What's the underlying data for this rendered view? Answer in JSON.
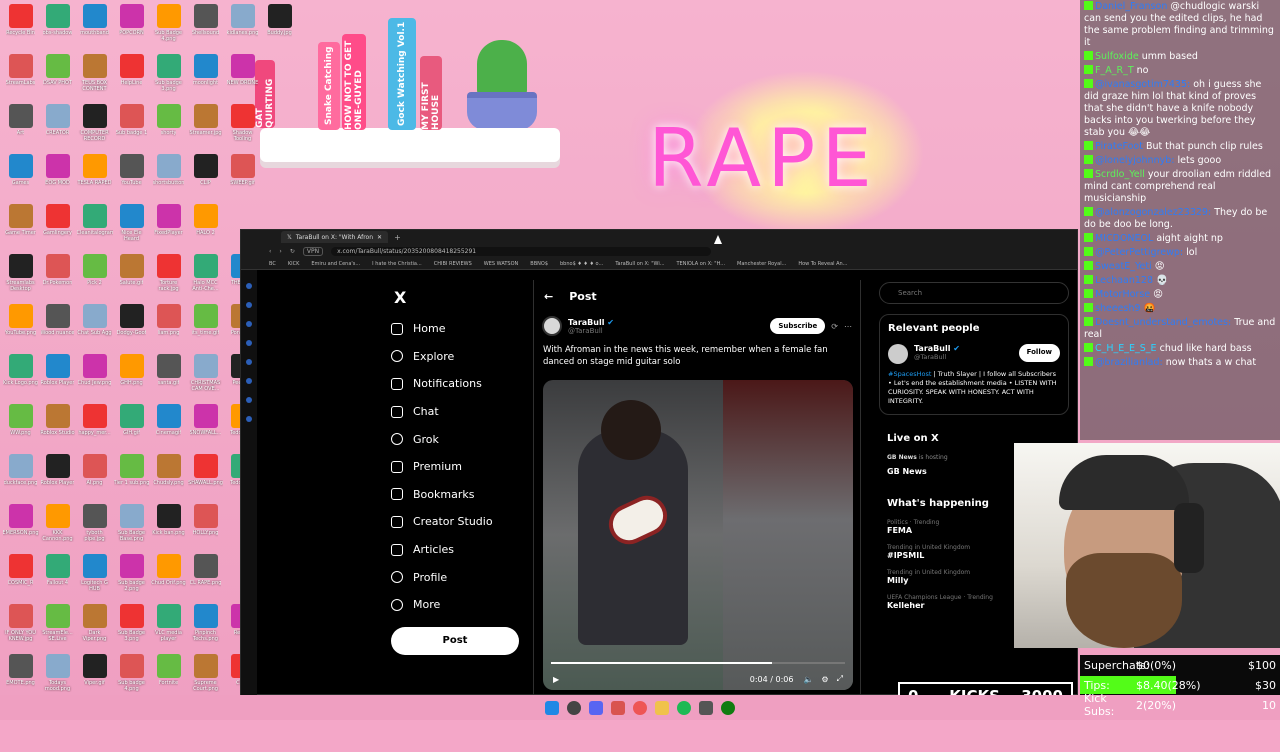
{
  "wallpaper": {
    "sign_text": "RAPE",
    "books": [
      "Snake Catching",
      "HOW NOT TO GET ONE-GUYED",
      "Gock Watching Vol.1",
      "MY FIRST HOUSE",
      "GAT QUIRTING"
    ]
  },
  "desktop_icons": [
    "Recycle Bin",
    "obs-shadow",
    "mouthband",
    "POPCORN",
    "Sub Badge 4.png",
    "Shellsound",
    "kidlanes.png",
    "Buddy.jpg",
    "StreamLabs",
    "DSAV PHOT",
    "TEUS BOX CONTENT",
    "HelpLine",
    "Sub badge 3.png",
    "moonlight",
    "NEW DRONE",
    "",
    "Art",
    "CREATOR",
    "COMPUTER RECORD",
    "Sub badge 1",
    "shorty",
    "Streamer.jpg",
    "Shadow Tooling",
    "",
    "Games",
    "EOG MOD",
    "TESLA RAPED",
    "YouTube",
    "shortsbutton",
    "CLIP",
    "SWEEP.gif",
    "",
    "Game Timer",
    "Gamlingery",
    "Cleanitalogram",
    "Nice Ele Heard",
    "FixedPlayer",
    "HALO 2",
    "",
    "",
    "Streamlabs Desktop",
    "Dr.Pokemon",
    "Pick 2",
    "Salute.gif",
    "Torture rack.jpg",
    "Halo MCC Anti-Che...",
    "THE SELL",
    "",
    "YouTube.png",
    "Wood nuance",
    "Chat Sub Agg",
    "Dodgy-Goof",
    "liam.png",
    "its_time.gif",
    "Pong.png",
    "",
    "Kick Logo.png",
    "Roblox Player",
    "Chud Jew.png",
    "GHH.png",
    "santa.gif",
    "CHRISTMAS CAM OVE...",
    "Pee.png",
    "",
    "WW.png",
    "Roblox Studio",
    "happy_mer...",
    "GIH.gif",
    "Cinemagif",
    "SNOWFALL...",
    "Teddy.png",
    "",
    "duckface.png",
    "Roblox Player",
    "AI.png",
    "Tier 1 sub.png",
    "Chudsly.png",
    "SHAWALL.png",
    "Teddy.png",
    "",
    "EMERSON.png",
    "KKK Cannon.png",
    "tyboth pipe.jpg",
    "Sub Badge Base.png",
    "Kick ban.png",
    "HOLLY.png",
    "",
    "",
    "COSMIC_R",
    "Fallout 4",
    "Logitech G HUB",
    "Sub badge 2.png",
    "Chud Orif.png",
    "CL RAPE.png",
    "",
    "",
    "IF ONLY YOU KNEW.jpg",
    "StreamEle... SE.Live",
    "Dark Viper.png",
    "Sub Badge 3.png",
    "VLC media player",
    "Pinpinch Techs.png",
    "Recent",
    "",
    "EMOTE.png",
    "Todays mood.png",
    "Viper.gif",
    "Sub badge 4.png",
    "Fortnite",
    "Supreme Court.png",
    "Chud",
    "",
    "",
    "",
    "",
    "",
    "",
    "",
    "",
    ""
  ],
  "browser": {
    "tab_title": "TaraBull on X: \"With Afron",
    "url": "x.com/TaraBull/status/2035200808418255291",
    "vpn": "VPN",
    "bookmarks": [
      "BC",
      "KICK",
      "Emiru and Cena's...",
      "I hate the Christia...",
      "CHIBI REVIEWS",
      "WES WATSON",
      "BBNO$",
      "bbno$ ♦ ♦ ♦ o...",
      "TaraBull on X: \"Wi...",
      "TENIOLA on X: \"H...",
      "Manchester Royal...",
      "How To Reveal An..."
    ]
  },
  "x": {
    "logo": "X",
    "nav": [
      {
        "label": "Home",
        "icon": "home-icon"
      },
      {
        "label": "Explore",
        "icon": "search-icon"
      },
      {
        "label": "Notifications",
        "icon": "bell-icon"
      },
      {
        "label": "Chat",
        "icon": "mail-icon"
      },
      {
        "label": "Grok",
        "icon": "grok-icon"
      },
      {
        "label": "Premium",
        "icon": "premium-icon"
      },
      {
        "label": "Bookmarks",
        "icon": "bookmark-icon"
      },
      {
        "label": "Creator Studio",
        "icon": "rocket-icon"
      },
      {
        "label": "Articles",
        "icon": "article-icon"
      },
      {
        "label": "Profile",
        "icon": "person-icon"
      },
      {
        "label": "More",
        "icon": "more-icon"
      }
    ],
    "post_button": "Post",
    "post_header": "Post",
    "post": {
      "author": "TaraBull",
      "handle": "@TaraBull",
      "subscribe": "Subscribe",
      "text": "With Afroman in the news this week, remember when a female fan danced on stage mid guitar solo",
      "video_time": "0:04 / 0:06",
      "video_progress": 0.75
    },
    "search_placeholder": "Search",
    "relevant": {
      "title": "Relevant people",
      "name": "TaraBull",
      "handle": "@TaraBull",
      "follow": "Follow",
      "bio_tag": "#SpacesHost",
      "bio": "| Truth Slayer | I follow all Subscribers • Let's end the establishment media • LISTEN WITH CURIOSITY. SPEAK WITH HONESTY. ACT WITH INTEGRITY."
    },
    "live": {
      "title": "Live on X",
      "host": "GB News",
      "hosting": "is hosting",
      "show": "GB News"
    },
    "happening": {
      "title": "What's happening",
      "trends": [
        {
          "cat": "Politics · Trending",
          "name": "FEMA"
        },
        {
          "cat": "Trending in United Kingdom",
          "name": "#IPSMIL"
        },
        {
          "cat": "Trending in United Kingdom",
          "name": "Milly"
        },
        {
          "cat": "UEFA Champions League · Trending",
          "name": "Kelleher"
        }
      ]
    }
  },
  "chat": [
    {
      "user": "Daniel_Franson",
      "cls": "",
      "text": "@chudlogic warski can send you the edited clips, he had the same problem finding and trimming it"
    },
    {
      "user": "Sulfoxide",
      "cls": "g",
      "text": "umm based"
    },
    {
      "user": "F_A_R_T",
      "cls": "g",
      "text": "no"
    },
    {
      "user": "@ivanasgotim7435:",
      "cls": "",
      "text": "oh i guess she did graze him lol that kind of proves that she didn't have a knife nobody backs into you twerking before they stab you 😂😂"
    },
    {
      "user": "PirateFoot",
      "cls": "",
      "text": "But that punch clip rules"
    },
    {
      "user": "@lonelyjohnnyb:",
      "cls": "",
      "text": "lets gooo"
    },
    {
      "user": "Scrdlo_Yell",
      "cls": "g",
      "text": "your droolian edm riddled mind cant comprehend real musicianship"
    },
    {
      "user": "@alonzogonzalez23329:",
      "cls": "",
      "text": "They do be do be doo be long."
    },
    {
      "user": "MICDONEOL",
      "cls": "",
      "text": "aight aight np"
    },
    {
      "user": "@PeterPettigrewp:",
      "cls": "",
      "text": "lol"
    },
    {
      "user": "SweatE_Yeti",
      "cls": "",
      "text": "😡"
    },
    {
      "user": "Lechaan128",
      "cls": "",
      "text": "💀"
    },
    {
      "user": "MotorHorse",
      "cls": "",
      "text": "😡"
    },
    {
      "user": "sheeesh9",
      "cls": "",
      "text": "🤬"
    },
    {
      "user": "Doesnt_understand_emotes:",
      "cls": "",
      "text": "True and real"
    },
    {
      "user": "C_H_E_E_S_E",
      "cls": "b",
      "text": "chud like hard bass"
    },
    {
      "user": "@brazilianlad:",
      "cls": "",
      "text": "now thats a w chat"
    }
  ],
  "goals": {
    "rows": [
      {
        "label": "Superchats:",
        "value": "$0(0%)",
        "target": "$100",
        "fill": 0
      },
      {
        "label": "Tips:",
        "value": "$8.40(28%)",
        "target": "$30",
        "fill": 0.28
      },
      {
        "label": "Kick Subs:",
        "value": "2(20%)",
        "target": "10",
        "fill": 0.2
      }
    ]
  },
  "kicks": {
    "count": "0",
    "label": "KICKS",
    "target": "3000"
  },
  "colors": {
    "accent": "#53fc18",
    "x_blue": "#1d9bf0",
    "sign_pink": "#ff56d5",
    "wallpaper": "#f4a7c8"
  }
}
